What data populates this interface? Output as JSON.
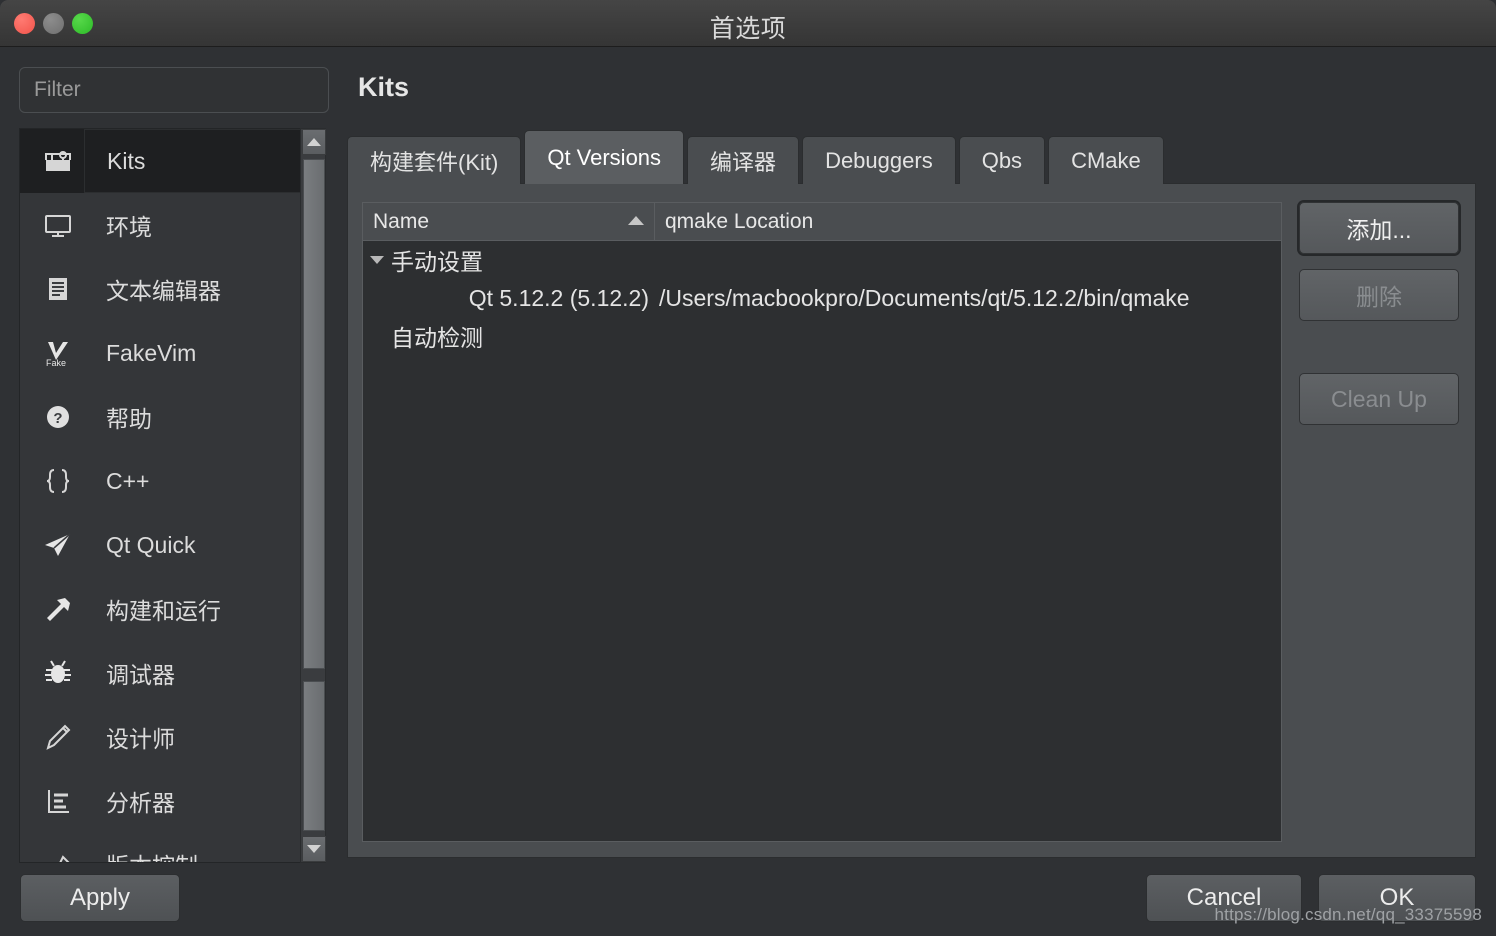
{
  "window": {
    "title": "首选项",
    "traffic_lights": [
      "close-button",
      "minimize-button",
      "zoom-button"
    ]
  },
  "filter": {
    "placeholder": "Filter",
    "value": ""
  },
  "sidebar": {
    "items": [
      {
        "label": "Kits",
        "icon": "toolbox-icon",
        "selected": true
      },
      {
        "label": "环境",
        "icon": "monitor-icon",
        "selected": false
      },
      {
        "label": "文本编辑器",
        "icon": "document-icon",
        "selected": false
      },
      {
        "label": "FakeVim",
        "icon": "fakevim-icon",
        "selected": false
      },
      {
        "label": "帮助",
        "icon": "question-icon",
        "selected": false
      },
      {
        "label": "C++",
        "icon": "braces-icon",
        "selected": false
      },
      {
        "label": "Qt Quick",
        "icon": "paper-plane-icon",
        "selected": false
      },
      {
        "label": "构建和运行",
        "icon": "hammer-icon",
        "selected": false
      },
      {
        "label": "调试器",
        "icon": "bug-icon",
        "selected": false
      },
      {
        "label": "设计师",
        "icon": "pencil-icon",
        "selected": false
      },
      {
        "label": "分析器",
        "icon": "analyzer-icon",
        "selected": false
      },
      {
        "label": "版本控制",
        "icon": "branch-icon",
        "selected": false
      }
    ],
    "scrollbar": {
      "up_icon": "scroll-up-arrow",
      "down_icon": "scroll-down-arrow"
    }
  },
  "page": {
    "title": "Kits"
  },
  "tabs": [
    {
      "label": "构建套件(Kit)",
      "active": false
    },
    {
      "label": "Qt Versions",
      "active": true
    },
    {
      "label": "编译器",
      "active": false
    },
    {
      "label": "Debuggers",
      "active": false
    },
    {
      "label": "Qbs",
      "active": false
    },
    {
      "label": "CMake",
      "active": false
    }
  ],
  "table": {
    "columns": [
      {
        "label": "Name",
        "sort": "ascending"
      },
      {
        "label": "qmake Location",
        "sort": "none"
      }
    ],
    "rows": [
      {
        "type": "group",
        "name": "手动设置",
        "qmake": "",
        "expanded": true
      },
      {
        "type": "child",
        "name": "Qt 5.12.2 (5.12.2)",
        "qmake": "/Users/macbookpro/Documents/qt/5.12.2/bin/qmake"
      },
      {
        "type": "group",
        "name": "自动检测",
        "qmake": "",
        "expanded": false
      }
    ]
  },
  "side_buttons": [
    {
      "label": "添加...",
      "enabled": true,
      "focused": true
    },
    {
      "label": "删除",
      "enabled": false,
      "focused": false
    },
    {
      "label": "Clean Up",
      "enabled": false,
      "focused": false
    }
  ],
  "footer": {
    "apply": "Apply",
    "cancel": "Cancel",
    "ok": "OK",
    "watermark": "https://blog.csdn.net/qq_33375598"
  },
  "colors": {
    "window_bg": "#2f3134",
    "titlebar": "#3c3c3c",
    "panel": "#4a4d50",
    "table_bg": "#2d2f31",
    "text": "#e4e4e4",
    "selected_row": "#1e1f21",
    "close_red": "#f1544b",
    "min_gray": "#6f6f6f",
    "zoom_green": "#2dbb28"
  }
}
